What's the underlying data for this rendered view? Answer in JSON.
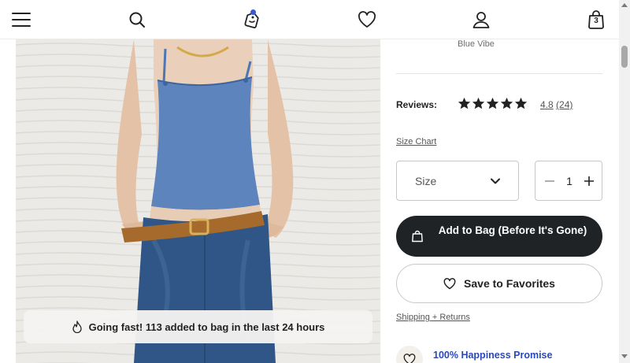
{
  "nav": {
    "bag_count": "3",
    "icons": [
      "menu-icon",
      "search-icon",
      "tag-icon",
      "heart-icon",
      "account-icon",
      "bag-icon"
    ]
  },
  "product": {
    "color_name": "Blue Vibe",
    "reviews_label": "Reviews:",
    "rating_value": "4.8",
    "rating_count": "(24)",
    "stars_filled": 5,
    "size_chart_link": "Size Chart",
    "size_select_value": "Size",
    "quantity": "1",
    "add_to_bag_label": "Add to Bag (Before It's Gone)",
    "favorites_label": "Save to Favorites",
    "shipping_link": "Shipping + Returns",
    "promise_text": "100% Happiness Promise"
  },
  "promo": {
    "text": "Going fast! 113 added to bag in the last 24 hours",
    "icon": "flame-icon"
  },
  "colors": {
    "button_dark": "#1f2326",
    "promise_blue": "#2b48b8",
    "notification_dot": "#3a57d6"
  }
}
